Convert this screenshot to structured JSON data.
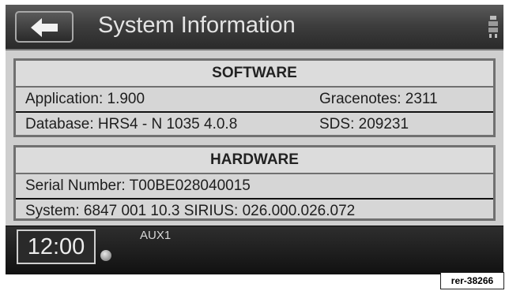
{
  "header": {
    "back_icon": "back-arrow-icon",
    "title": "System Information",
    "menu_icon": "device-icon"
  },
  "software": {
    "heading": "SOFTWARE",
    "application": "Application: 1.900",
    "gracenotes": "Gracenotes: 2311",
    "database": "Database: HRS4 - N 1035 4.0.8",
    "sds": "SDS: 209231"
  },
  "hardware": {
    "heading": "HARDWARE",
    "serial": "Serial Number: T00BE028040015",
    "system_sirius": "System: 6847 001 10.3  SIRIUS: 026.000.026.072"
  },
  "status_bar": {
    "clock": "12:00",
    "source": "AUX1",
    "globe_icon": "globe-icon"
  },
  "reference_code": "rer-38266",
  "colors": {
    "screen_bg": "#060606",
    "panel_bg": "#cfcfcf",
    "header_text": "#e4e4e4"
  }
}
